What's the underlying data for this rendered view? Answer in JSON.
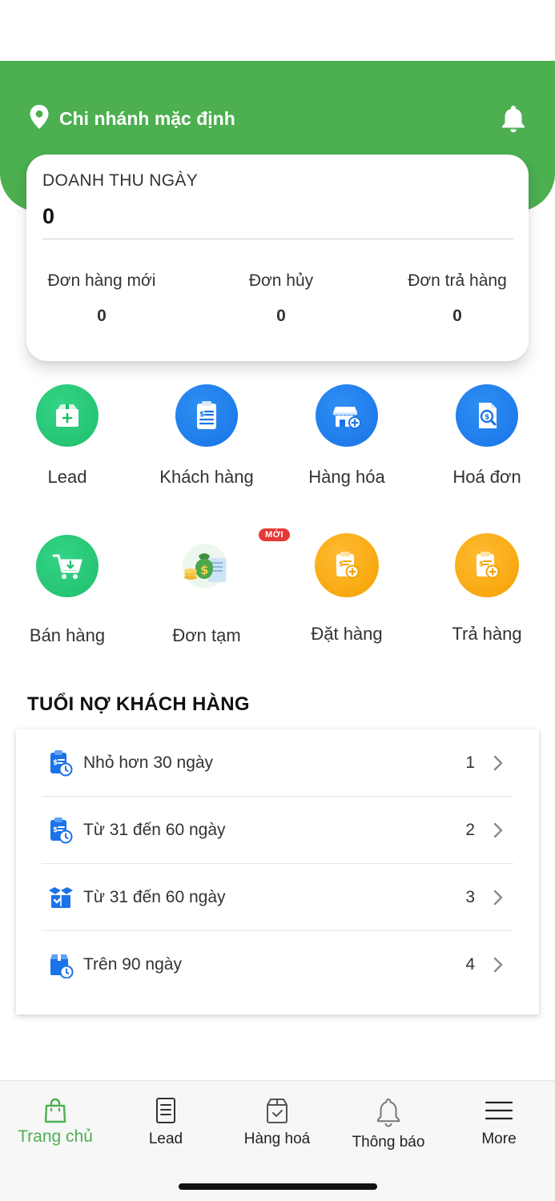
{
  "header": {
    "branch_label": "Chi nhánh mặc định",
    "branch_icon": "location-pin-icon",
    "bell_icon": "bell-icon",
    "color": "#4caf50"
  },
  "revenue": {
    "title": "DOANH THU NGÀY",
    "value": "0",
    "stats": [
      {
        "label": "Đơn hàng mới",
        "value": "0"
      },
      {
        "label": "Đơn hủy",
        "value": "0"
      },
      {
        "label": "Đơn trả hàng",
        "value": "0"
      }
    ]
  },
  "quick_actions": [
    {
      "label": "Lead",
      "icon": "box-plus-icon",
      "color": "green"
    },
    {
      "label": "Khách hàng",
      "icon": "clipboard-money-icon",
      "color": "blue"
    },
    {
      "label": "Hàng hóa",
      "icon": "store-plus-icon",
      "color": "blue"
    },
    {
      "label": "Hoá đơn",
      "icon": "invoice-search-icon",
      "color": "blue"
    },
    {
      "label": "Bán hàng",
      "icon": "cart-icon",
      "color": "green"
    },
    {
      "label": "Đơn tạm",
      "icon": "money-bag-icon",
      "color": "none",
      "badge": "MỚI"
    },
    {
      "label": "Đặt hàng",
      "icon": "order-plus-icon",
      "color": "orange"
    },
    {
      "label": "Trả hàng",
      "icon": "return-plus-icon",
      "color": "orange"
    }
  ],
  "debt": {
    "title": "TUỔI NỢ KHÁCH HÀNG",
    "rows": [
      {
        "label": "Nhỏ hơn 30 ngày",
        "count": "1",
        "icon": "clipboard-clock-icon"
      },
      {
        "label": "Từ 31 đến 60 ngày",
        "count": "2",
        "icon": "clipboard-clock-icon"
      },
      {
        "label": "Từ 31 đến 60 ngày",
        "count": "3",
        "icon": "open-box-icon"
      },
      {
        "label": "Trên 90 ngày",
        "count": "4",
        "icon": "box-clock-icon"
      }
    ]
  },
  "tabbar": {
    "tabs": [
      {
        "label": "Trang chủ",
        "icon": "shopping-bag-icon",
        "active": true
      },
      {
        "label": "Lead",
        "icon": "document-icon",
        "active": false
      },
      {
        "label": "Hàng hoá",
        "icon": "package-check-icon",
        "active": false
      },
      {
        "label": "Thông báo",
        "icon": "bell-outline-icon",
        "active": false
      },
      {
        "label": "More",
        "icon": "menu-icon",
        "active": false
      }
    ],
    "active_color": "#4caf50"
  }
}
